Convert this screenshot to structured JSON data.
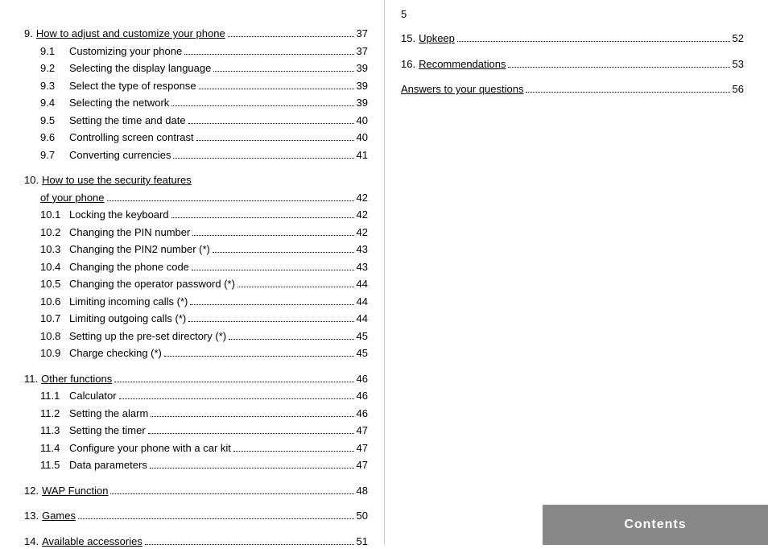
{
  "left": {
    "entries": [
      {
        "type": "main",
        "number": "9.",
        "label": "How to adjust and customize your phone",
        "underline": true,
        "dots": true,
        "page": "37"
      },
      {
        "type": "sub",
        "number": "9.1",
        "label": "Customizing your phone",
        "dots": true,
        "page": "37"
      },
      {
        "type": "sub",
        "number": "9.2",
        "label": "Selecting the display language",
        "dots": true,
        "page": "39"
      },
      {
        "type": "sub",
        "number": "9.3",
        "label": "Select the type of response",
        "dots": true,
        "page": "39"
      },
      {
        "type": "sub",
        "number": "9.4",
        "label": "Selecting the network",
        "dots": true,
        "page": "39"
      },
      {
        "type": "sub",
        "number": "9.5",
        "label": "Setting the time and date",
        "dots": true,
        "page": "40"
      },
      {
        "type": "sub",
        "number": "9.6",
        "label": "Controlling screen contrast",
        "dots": true,
        "page": "40"
      },
      {
        "type": "sub",
        "number": "9.7",
        "label": "Converting currencies",
        "dots": true,
        "page": "41"
      },
      {
        "type": "main2line",
        "number": "10.",
        "label1": "How to use the security features",
        "label2": "of your phone",
        "underline": true,
        "dots": true,
        "page": "42"
      },
      {
        "type": "sub",
        "number": "10.1",
        "label": "Locking the keyboard",
        "dots": true,
        "page": "42"
      },
      {
        "type": "sub",
        "number": "10.2",
        "label": "Changing the PIN number",
        "dots": true,
        "page": "42"
      },
      {
        "type": "sub",
        "number": "10.3",
        "label": "Changing the PIN2 number (*)",
        "dots": true,
        "page": "43"
      },
      {
        "type": "sub",
        "number": "10.4",
        "label": "Changing the phone code",
        "dots": true,
        "page": "43"
      },
      {
        "type": "sub",
        "number": "10.5",
        "label": "Changing the operator password (*)",
        "dots": true,
        "page": "44"
      },
      {
        "type": "sub",
        "number": "10.6",
        "label": "Limiting incoming calls (*)",
        "dots": true,
        "page": "44"
      },
      {
        "type": "sub",
        "number": "10.7",
        "label": "Limiting outgoing calls (*)",
        "dots": true,
        "page": "44"
      },
      {
        "type": "sub",
        "number": "10.8",
        "label": "Setting up the pre-set directory (*)",
        "dots": true,
        "page": "45"
      },
      {
        "type": "sub",
        "number": "10.9",
        "label": "Charge checking (*)",
        "dots": true,
        "page": "45"
      },
      {
        "type": "main",
        "number": "11.",
        "label": "Other functions",
        "underline": true,
        "dots": true,
        "page": "46"
      },
      {
        "type": "sub",
        "number": "11.1",
        "label": "Calculator",
        "dots": true,
        "page": "46"
      },
      {
        "type": "sub",
        "number": "11.2",
        "label": "Setting the alarm",
        "dots": true,
        "page": "46"
      },
      {
        "type": "sub",
        "number": "11.3",
        "label": "Setting the timer",
        "dots": true,
        "page": "47"
      },
      {
        "type": "sub",
        "number": "11.4",
        "label": "Configure your phone with a car kit",
        "dots": true,
        "page": "47"
      },
      {
        "type": "sub",
        "number": "11.5",
        "label": "Data parameters",
        "dots": true,
        "page": "47"
      },
      {
        "type": "main",
        "number": "12.",
        "label": "WAP Function",
        "underline": true,
        "dots": true,
        "page": "48"
      },
      {
        "type": "main",
        "number": "13.",
        "label": "Games",
        "underline": true,
        "dots": true,
        "page": "50"
      },
      {
        "type": "main",
        "number": "14.",
        "label": "Available accessories",
        "underline": true,
        "dots": true,
        "page": "51"
      }
    ]
  },
  "right": {
    "page_number": "5",
    "entries": [
      {
        "type": "main",
        "number": "15.",
        "label": "Upkeep",
        "underline": true,
        "dots": true,
        "page": "52"
      },
      {
        "type": "main",
        "number": "16.",
        "label": "Recommendations",
        "underline": true,
        "dots": true,
        "page": "53"
      },
      {
        "type": "nonnumbered",
        "label": "Answers to your questions",
        "underline": false,
        "dots": true,
        "page": "56"
      }
    ],
    "banner": {
      "text": "Contents"
    }
  }
}
